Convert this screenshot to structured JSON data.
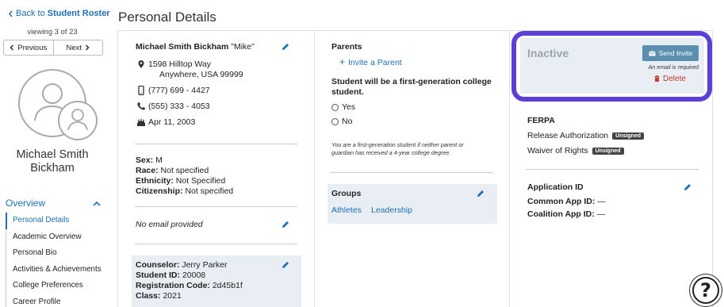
{
  "sidebar": {
    "back_prefix": "Back to ",
    "back_label": "Student Roster",
    "viewing": "viewing 3 of 23",
    "prev_label": "Previous",
    "next_label": "Next",
    "student_name_line1": "Michael Smith",
    "student_name_line2": "Bickham",
    "overview_label": "Overview",
    "nav_items": [
      {
        "label": "Personal Details",
        "active": true
      },
      {
        "label": "Academic Overview",
        "active": false
      },
      {
        "label": "Personal Bio",
        "active": false
      },
      {
        "label": "Activities & Achievements",
        "active": false
      },
      {
        "label": "College Preferences",
        "active": false
      },
      {
        "label": "Career Profile",
        "active": false
      }
    ]
  },
  "page_title": "Personal Details",
  "profile": {
    "full_name": "Michael Smith Bickham",
    "nickname": "\"Mike\"",
    "address_line1": "1598 Hilltop Way",
    "address_line2": "Anywhere, USA 99999",
    "mobile_phone": "(777) 699 - 4427",
    "home_phone": "(555) 333 - 4053",
    "birthday": "Apr 11, 2003",
    "sex_label": "Sex:",
    "sex_value": "M",
    "race_label": "Race:",
    "race_value": "Not specified",
    "ethnicity_label": "Ethnicity:",
    "ethnicity_value": "Not Specified",
    "citizenship_label": "Citizenship:",
    "citizenship_value": "Not specified",
    "email": "No email provided"
  },
  "counselor": {
    "counselor_label": "Counselor:",
    "counselor_value": "Jerry Parker",
    "student_id_label": "Student ID:",
    "student_id_value": "20008",
    "reg_code_label": "Registration Code:",
    "reg_code_value": "2d45b1f",
    "class_label": "Class:",
    "class_value": "2021"
  },
  "parents": {
    "heading": "Parents",
    "invite_label": "Invite a Parent",
    "first_gen_question_line1": "Student will be a first-generation college",
    "first_gen_question_line2": "student.",
    "yes_label": "Yes",
    "no_label": "No",
    "note_line1": "You are a first-generation student if neither parent or",
    "note_line2": "guardian has received a 4-year college degree."
  },
  "groups": {
    "heading": "Groups",
    "items": [
      "Athletes",
      "Leadership"
    ]
  },
  "account": {
    "status": "Inactive",
    "send_invite_label": "Send Invite",
    "email_required": "An email is required",
    "delete_label": "Delete"
  },
  "ferpa": {
    "heading": "FERPA",
    "release_label": "Release Authorization",
    "release_status": "Unsigned",
    "waiver_label": "Waiver of Rights",
    "waiver_status": "Unsigned"
  },
  "application": {
    "heading": "Application ID",
    "common_app_label": "Common App ID:",
    "common_app_value": "—",
    "coalition_label": "Coalition App ID:",
    "coalition_value": "—"
  },
  "help_label": "?",
  "colors": {
    "link": "#1f6fb2",
    "highlight_outline": "#5b3fd6",
    "panel_bg": "#e8eef3",
    "send_button": "#5a8fb0",
    "delete": "#c0392b"
  },
  "icons": {
    "pencil": "edit-pencil-icon",
    "map": "map-pin-icon",
    "mobile": "mobile-phone-icon",
    "phone": "phone-icon",
    "cake": "birthday-cake-icon",
    "mail": "mail-icon",
    "trash": "trash-icon",
    "plus": "plus-icon",
    "help": "help-icon"
  }
}
